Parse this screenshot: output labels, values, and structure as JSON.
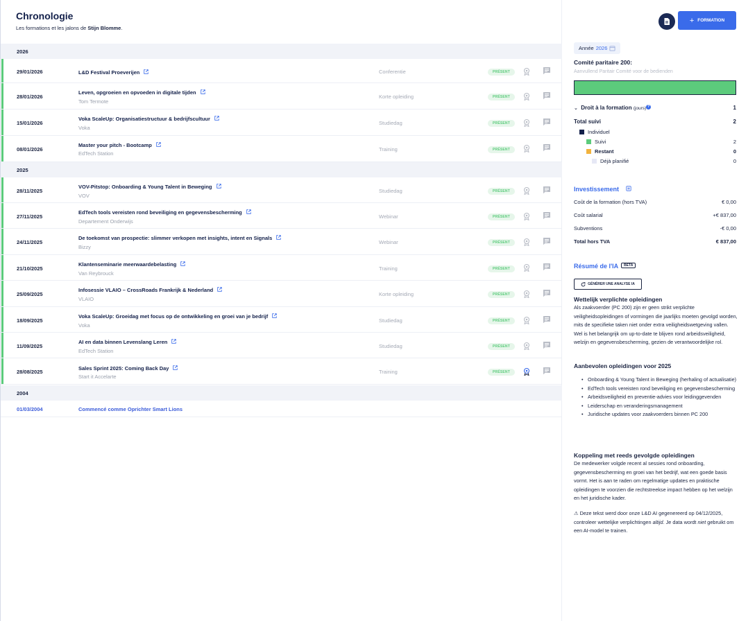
{
  "header": {
    "title": "Chronologie",
    "subtitle_prefix": "Les formations et les jalons de",
    "person": "Stijn Blomme",
    "subtitle_suffix": "."
  },
  "timeline": {
    "years": [
      "2026",
      "2025",
      "2004"
    ],
    "events_2026": [
      {
        "date": "29/01/2026",
        "title": "L&D Festival Proeverijen",
        "org": "",
        "type": "Conferentie",
        "status": "PRÉSENT"
      },
      {
        "date": "28/01/2026",
        "title": "Leven, opgroeien en opvoeden in digitale tijden",
        "org": "Tom Termote",
        "type": "Korte opleiding",
        "status": "PRÉSENT"
      },
      {
        "date": "15/01/2026",
        "title": "Voka ScaleUp: Organisatiestructuur & bedrijfscultuur",
        "org": "Voka",
        "type": "Studiedag",
        "status": "PRÉSENT"
      },
      {
        "date": "08/01/2026",
        "title": "Master your pitch - Bootcamp",
        "org": "EdTech Station",
        "type": "Training",
        "status": "PRÉSENT"
      }
    ],
    "events_2025": [
      {
        "date": "28/11/2025",
        "title": "VOV-Pitstop: Onboarding & Young Talent in Beweging",
        "org": "VOV",
        "type": "Studiedag",
        "status": "PRÉSENT"
      },
      {
        "date": "27/11/2025",
        "title": "EdTech tools vereisten rond beveiliging en gegevensbescherming",
        "org": "Departement Onderwijs",
        "type": "Webinar",
        "status": "PRÉSENT"
      },
      {
        "date": "24/11/2025",
        "title": "De toekomst van prospectie: slimmer verkopen met insights, intent en Signals",
        "org": "Bizzy",
        "type": "Webinar",
        "status": "PRÉSENT"
      },
      {
        "date": "21/10/2025",
        "title": "Klantenseminarie meerwaardebelasting",
        "org": "Van Reybrouck",
        "type": "Training",
        "status": "PRÉSENT"
      },
      {
        "date": "25/09/2025",
        "title": "Infosessie VLAIO – CrossRoads Frankrijk & Nederland",
        "org": "VLAIO",
        "type": "Korte opleiding",
        "status": "PRÉSENT"
      },
      {
        "date": "18/09/2025",
        "title": "Voka ScaleUp: Groeidag met focus op de ontwikkeling en groei van je bedrijf",
        "org": "Voka",
        "type": "Studiedag",
        "status": "PRÉSENT"
      },
      {
        "date": "11/09/2025",
        "title": "AI en data binnen Levenslang Leren",
        "org": "EdTech Station",
        "type": "Studiedag",
        "status": "PRÉSENT"
      },
      {
        "date": "28/08/2025",
        "title": "Sales Sprint 2025: Coming Back Day",
        "org": "Start it Accelarte",
        "type": "Training",
        "status": "PRÉSENT"
      }
    ],
    "milestone_2004": {
      "date": "01/03/2004",
      "title": "Commencé comme Oprichter Smart Lions"
    }
  },
  "sidebar": {
    "add_button": "FORMATION",
    "year_label": "Année",
    "year_value": "2026",
    "committee_title": "Comité paritaire 200:",
    "committee_sub": "Aanvullend Paritair Comité voor de bedienden",
    "progress_fraction": 1.0,
    "droit_label": "Droit à la formation",
    "droit_unit": "(jours)",
    "droit_value": "1",
    "total_label": "Total suivi",
    "total_value": "2",
    "individuel": "Individuel",
    "suivi_label": "Suivi",
    "suivi_value": "2",
    "restant_label": "Restant",
    "restant_value": "0",
    "planifie_label": "Déjà planifié",
    "planifie_value": "0",
    "colors": {
      "individuel": "#13204a",
      "suivi": "#5ccb7c",
      "restant": "#f2b33d",
      "planifie": "#e6e8f5"
    }
  },
  "investment": {
    "title": "Investissement",
    "rows": [
      {
        "label": "Coût de la formation (hors TVA)",
        "value": "€ 0,00"
      },
      {
        "label": "Coût salarial",
        "value": "+€ 837,00"
      },
      {
        "label": "Subventions",
        "value": "-€ 0,00"
      },
      {
        "label": "Total hors TVA",
        "value": "€ 837,00"
      }
    ]
  },
  "ai": {
    "title": "Résumé de l'IA",
    "beta": "BETA",
    "button": "GÉNÉRER UNE ANALYSE IA",
    "h1": "Wettelijk verplichte opleidingen",
    "p1": "Als zaakvoerder (PC 200) zijn er geen strikt verplichte veiligheidsopleidingen of vormingen die jaarlijks moeten gevolgd worden, mits de specifieke taken niet onder extra veiligheidswetgeving vallen. Wel is het belangrijk om up-to-date te blijven rond arbeidsveiligheid, welzijn en gegevensbescherming, gezien de verantwoordelijke rol.",
    "h2": "Aanbevolen opleidingen voor 2025",
    "list": [
      "Onboarding & Young Talent in Beweging (herhaling of actualisatie)",
      "EdTech tools vereisten rond beveiliging en gegevensbescherming",
      "Arbeidsveiligheid en preventie-advies voor leidinggevenden",
      "Leiderschap en veranderingsmanagement",
      "Juridische updates voor zaakvoerders binnen PC 200"
    ],
    "h3": "Koppeling met reeds gevolgde opleidingen",
    "p3": "De medewerker volgde recent al sessies rond onboarding, gegevensbescherming en groei van het bedrijf, wat een goede basis vormt. Het is aan te raden om regelmatige updates en praktische opleidingen te voorzien die rechtstreekse impact hebben op het welzijn en het juridische kader.",
    "disclaimer_a": "⚠ Deze tekst werd door onze L&D AI gegenereerd op 04/12/2025, controleer wettelijke verplichtingen",
    "disclaimer_em1": "altijd",
    "disclaimer_b": ". Je data wordt",
    "disclaimer_em2": "niet",
    "disclaimer_c": "gebruikt om een AI-model te trainen."
  }
}
